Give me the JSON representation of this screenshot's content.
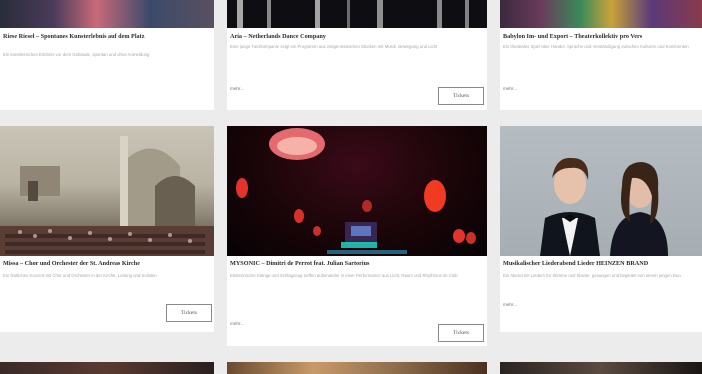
{
  "grid": {
    "cards": [
      {
        "id": "top-left",
        "title": "Riese Riesel – Spontanes Kunsterlebnis auf dem Platz",
        "description": "Ein künstlerisches Erlebnis vor dem Gebäude, spontan und ohne Anmeldung",
        "more": "",
        "button": ""
      },
      {
        "id": "top-middle",
        "title": "Aria – Netherlands Dance Company",
        "description": "Eine junge Tanzkompanie zeigt ein Programm aus zeitgenössischen Stücken mit Musik, Bewegung und Licht",
        "more": "mehr...",
        "button": "Tickets"
      },
      {
        "id": "top-right",
        "title": "Babylon Im- und Export – Theaterkollektiv pro Vers",
        "description": "Ein theatrales Spiel über Handel, Sprache und Verständigung zwischen Kulturen und Kontinenten",
        "more": "mehr...",
        "button": ""
      },
      {
        "id": "mid-left",
        "title": "Missa – Chor und Orchester der St. Andreas Kirche",
        "description": "Ein festliches Konzert mit Chor und Orchester in der Kirche, Leitung und Solisten",
        "more": "",
        "button": "Tickets"
      },
      {
        "id": "mid-middle",
        "title": "MYSONIC – Dimitri de Perrot feat. Julian Sartorius",
        "description": "Elektronische Klänge und Schlagzeug treffen aufeinander in einer Performance aus Licht, Raum und Rhythmus im Club",
        "more": "mehr...",
        "button": "Tickets"
      },
      {
        "id": "mid-right",
        "title": "Musikalischer Liederabend Lieder HEINZEN BRAND",
        "description": "Ein Abend mit Liedern für Stimme und Klavier, gesungen und begleitet von einem jungen Duo",
        "more": "mehr...",
        "button": ""
      }
    ]
  },
  "colors": {
    "background": "#ececec",
    "card": "#ffffff",
    "title": "#2c2c2c",
    "text": "#a8a8a8",
    "button_border": "#8a8a8a"
  }
}
